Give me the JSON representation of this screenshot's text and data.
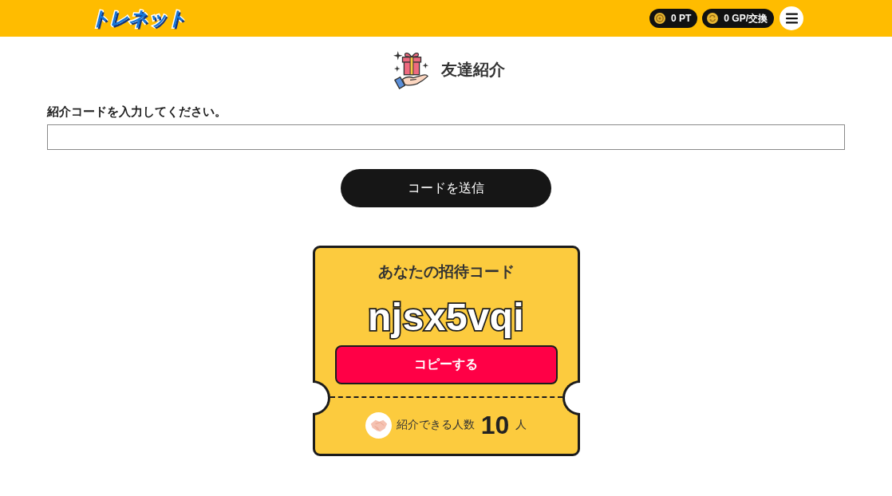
{
  "header": {
    "logo": "トレネット",
    "balances": [
      {
        "kind": "pt",
        "value": "0 PT"
      },
      {
        "kind": "gp",
        "value": "0 GP/交換"
      }
    ]
  },
  "page_title": "友達紹介",
  "code_form": {
    "label": "紹介コードを入力してください。",
    "submit_button": "コードを送信"
  },
  "invite_card": {
    "title": "あなたの招待コード",
    "code": "njsx5vqi",
    "copy_button": "コピーする",
    "count_label": "紹介できる人数",
    "count": "10",
    "count_unit": "人"
  }
}
